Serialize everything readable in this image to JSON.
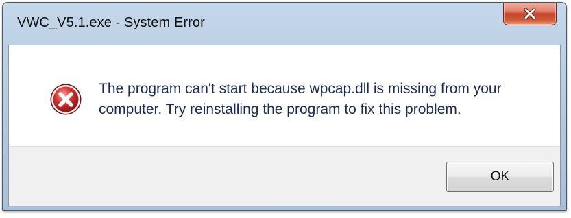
{
  "window": {
    "title": "VWC_V5.1.exe - System Error",
    "close_icon": "close-x-icon",
    "close_color": "#c8442b"
  },
  "dialog": {
    "icon": "error-icon",
    "icon_color": "#c0282c",
    "message_line1": "The program can't start because wpcap.dll is missing from your",
    "message_line2": "computer. Try reinstalling the program to fix this problem."
  },
  "buttons": {
    "ok_label": "OK"
  }
}
